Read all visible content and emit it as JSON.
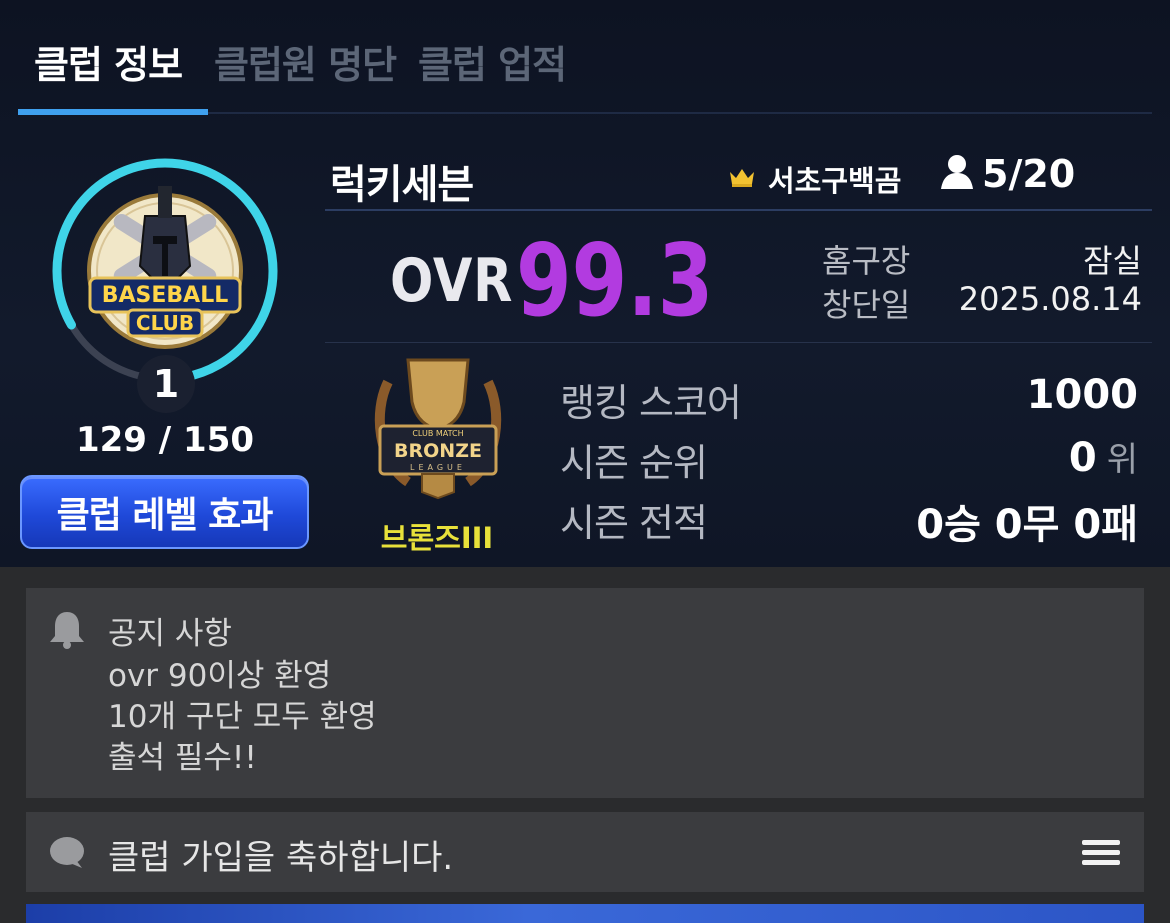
{
  "tabs": [
    {
      "label": "클럽 정보",
      "active": true
    },
    {
      "label": "클럽원 명단",
      "active": false
    },
    {
      "label": "클럽 업적",
      "active": false
    }
  ],
  "club": {
    "emblem_text_1": "BASEBALL",
    "emblem_text_2": "CLUB",
    "level": "1",
    "exp_text": "129 / 150",
    "exp_progress": 0.86,
    "level_button": "클럽 레벨 효과",
    "name": "럭키세븐",
    "leader": "서초구백곰",
    "members": "5/20",
    "ovr_label": "OVR",
    "ovr_value": "99.3",
    "home_label": "홈구장",
    "home_value": "잠실",
    "founded_label": "창단일",
    "founded_value": "2025.08.14"
  },
  "tier": {
    "badge_top": "CLUB MATCH",
    "badge_main": "BRONZE",
    "badge_sub": "LEAGUE",
    "name": "브론즈III"
  },
  "stats": [
    {
      "label": "랭킹 스코어",
      "value": "1000",
      "unit": ""
    },
    {
      "label": "시즌 순위",
      "value": "0",
      "unit": "위"
    },
    {
      "label": "시즌 전적",
      "value": "0승 0무 0패",
      "unit": ""
    }
  ],
  "notice": {
    "title": "공지 사항",
    "lines": [
      "ovr 90이상 환영",
      "10개 구단 모두 환영",
      "출석 필수!!"
    ]
  },
  "greeting": "클럽 가입을 축하합니다.",
  "icons": {
    "crown": "crown-icon",
    "member": "person-icon",
    "bell": "bell-icon",
    "chat": "chat-bubble-icon",
    "menu": "hamburger-menu-icon"
  },
  "colors": {
    "accent_tab": "#3fa0ee",
    "ovr": "#b23be0",
    "ring": "#3fd4e8",
    "tier_name": "#e8e13a",
    "button": "#1f49d9"
  }
}
